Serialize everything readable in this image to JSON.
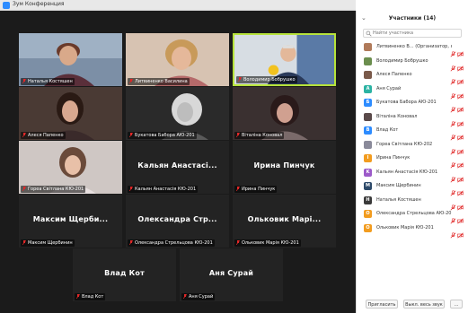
{
  "window": {
    "title": "Зум Конференция"
  },
  "gallery": {
    "tiles": [
      {
        "label": "Наталья Костяшен",
        "center": ""
      },
      {
        "label": "Литвиненко Василина",
        "center": ""
      },
      {
        "label": "Володимир Бобрушко",
        "center": ""
      },
      {
        "label": "Алеся Папенко",
        "center": ""
      },
      {
        "label": "Букатова Бабора АЮ-201",
        "center": ""
      },
      {
        "label": "Віталіна Коновал",
        "center": ""
      },
      {
        "label": "Гореа Світлана КЮ-201",
        "center": ""
      },
      {
        "label": "Кальян Анастасія КЮ-201",
        "center": "Кальян Анастасі..."
      },
      {
        "label": "Ирина Пинчук",
        "center": "Ирина Пинчук"
      },
      {
        "label": "Максим Щербинин",
        "center": "Максим Щерби..."
      },
      {
        "label": "Олександра Стрельцова КЮ-201",
        "center": "Олександра Стр..."
      },
      {
        "label": "Ольковик Марія КЮ-201",
        "center": "Ольковик Марі..."
      },
      {
        "label": "Влад Кот",
        "center": "Влад Кот"
      },
      {
        "label": "Аня Сурай",
        "center": "Аня Сурай"
      }
    ]
  },
  "participants": {
    "title": "Участники (14)",
    "search_placeholder": "Найти участника",
    "items": [
      {
        "avatar": "",
        "name": "Литвиненко В... (Организатор, я)",
        "color": "#b07a5a"
      },
      {
        "avatar": "",
        "name": "Володимир Бобрушко",
        "color": "#6b8e4e"
      },
      {
        "avatar": "",
        "name": "Алеся Папенко",
        "color": "#7a5a4a"
      },
      {
        "avatar": "A",
        "name": "Аня Сурай",
        "color": "#2bb3a3"
      },
      {
        "avatar": "Б",
        "name": "Букатова Бабора АЮ-201",
        "color": "#2d8cff"
      },
      {
        "avatar": "",
        "name": "Віталіна Коновал",
        "color": "#5a4a4a"
      },
      {
        "avatar": "B",
        "name": "Влад Кот",
        "color": "#2d8cff"
      },
      {
        "avatar": "",
        "name": "Гореа Світлана КЮ-202",
        "color": "#8a8a9a"
      },
      {
        "avatar": "I",
        "name": "Ирина Пинчук",
        "color": "#f29c1f"
      },
      {
        "avatar": "K",
        "name": "Кальян Анастасія КЮ-201",
        "color": "#9c5ac9"
      },
      {
        "avatar": "M",
        "name": "Максим Щербинин",
        "color": "#2d4a6a"
      },
      {
        "avatar": "H",
        "name": "Наталья Костяшен",
        "color": "#3a3a3a"
      },
      {
        "avatar": "O",
        "name": "Олександра Стрельцова АЮ-201",
        "color": "#f29c1f"
      },
      {
        "avatar": "O",
        "name": "Ольковик Марія КЮ-201",
        "color": "#f29c1f"
      }
    ],
    "invite_label": "Пригласить",
    "mute_all_label": "Выкл. весь звук",
    "more_label": "..."
  },
  "colors": {
    "accent": "#2d8cff",
    "active_speaker": "#b7e33b",
    "muted": "#e02828"
  }
}
